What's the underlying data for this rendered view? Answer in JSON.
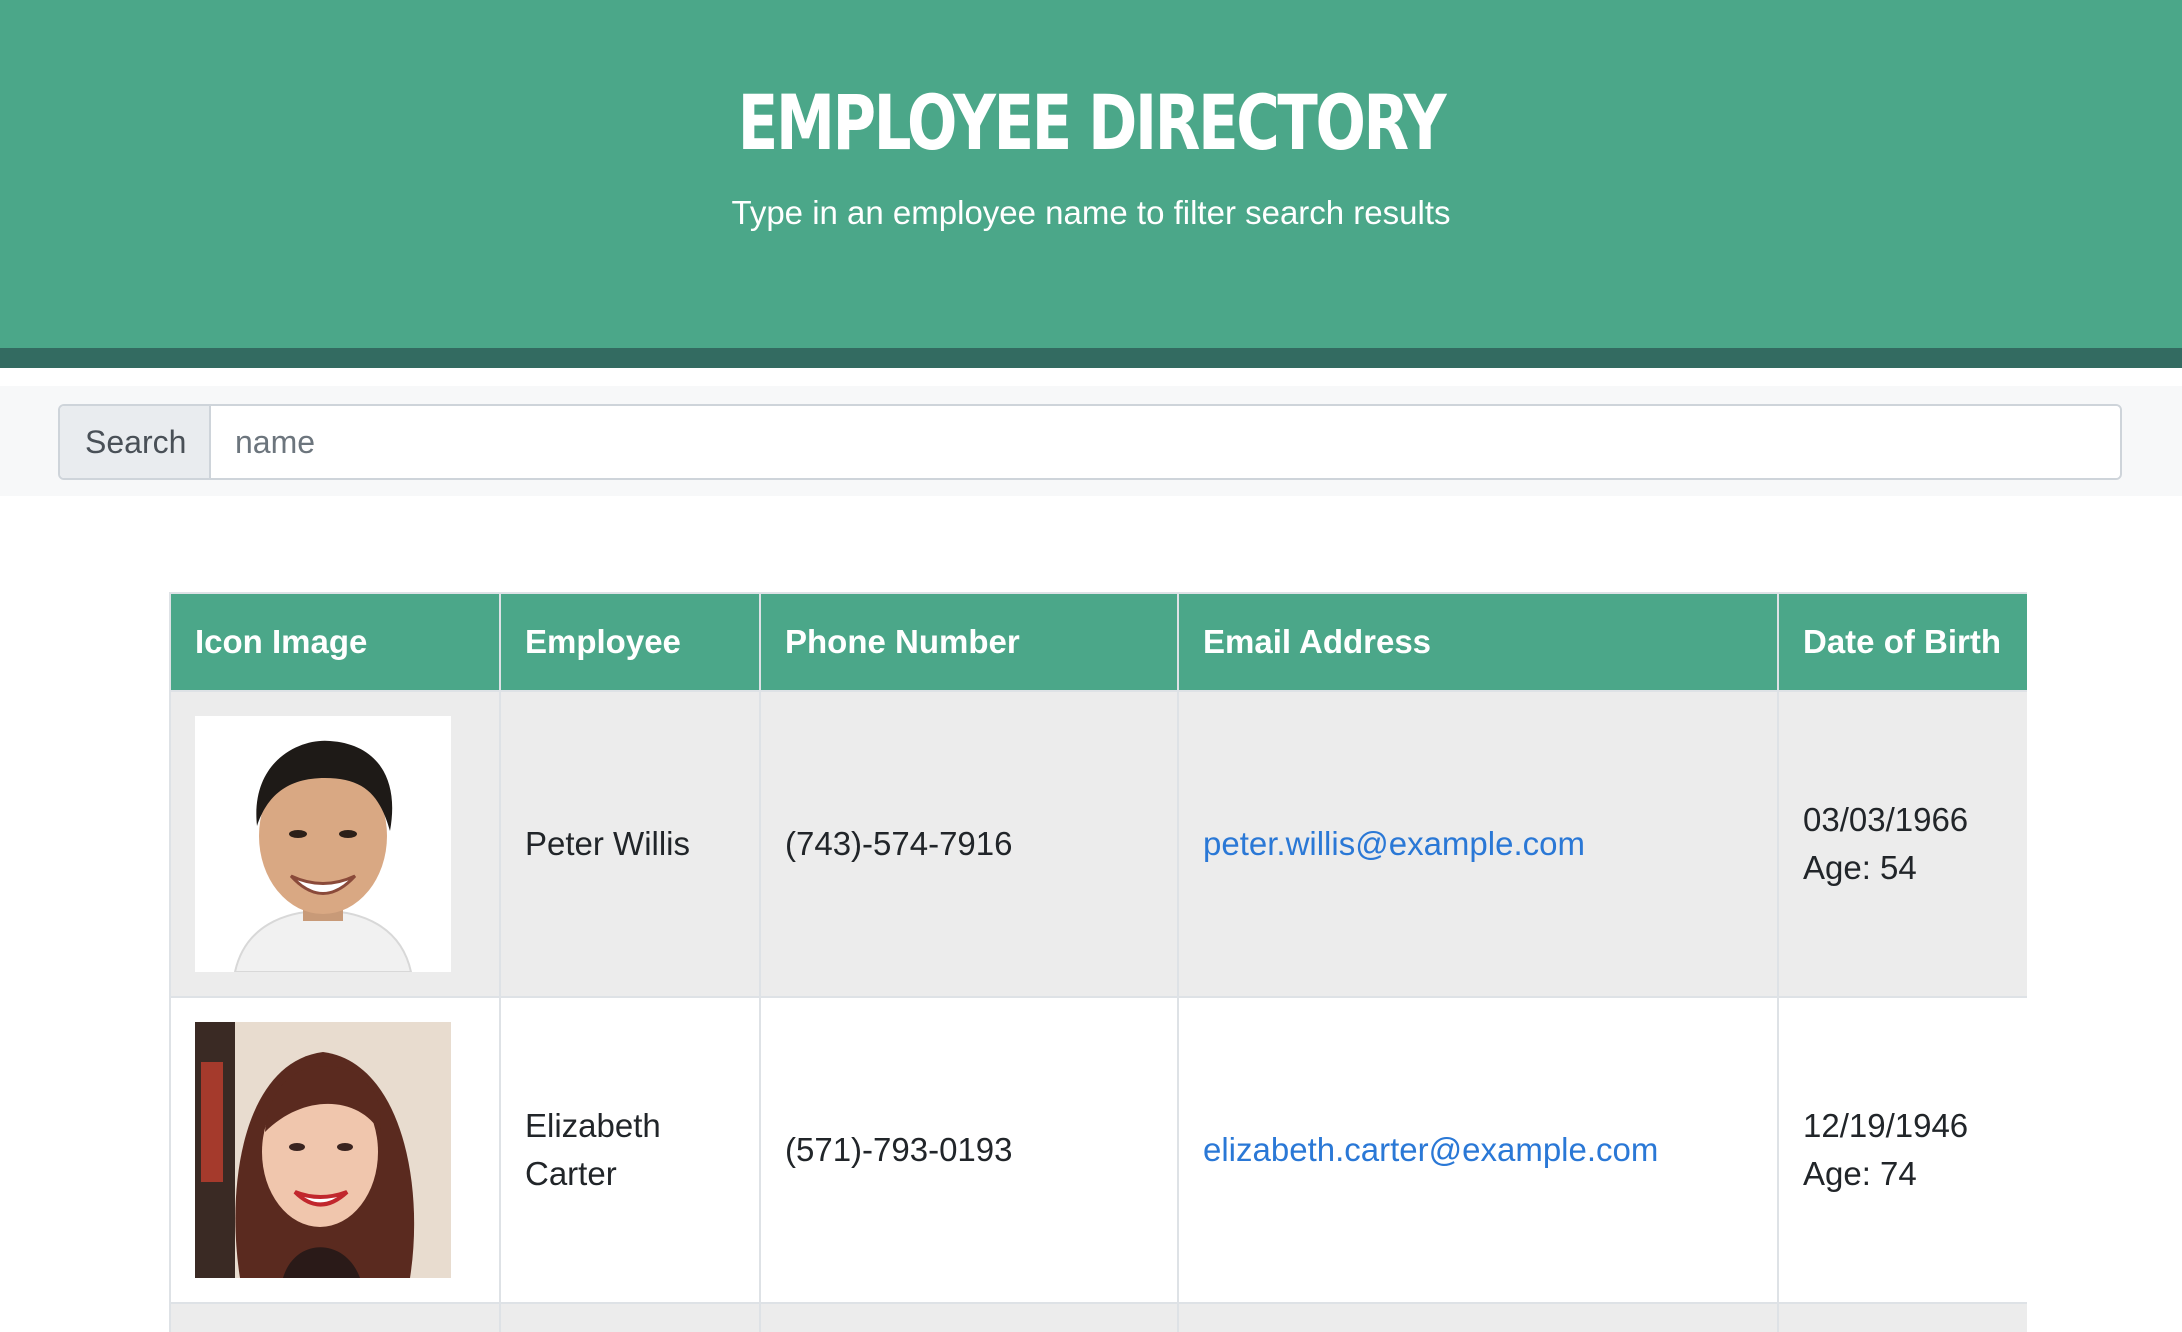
{
  "header": {
    "title": "EMPLOYEE DIRECTORY",
    "subtitle": "Type in an employee name to filter search results"
  },
  "search": {
    "label": "Search",
    "placeholder": "name"
  },
  "table": {
    "columns": [
      "Icon Image",
      "Employee",
      "Phone Number",
      "Email Address",
      "Date of Birth"
    ],
    "rows": [
      {
        "name": "Peter Willis",
        "phone": "(743)-574-7916",
        "email": "peter.willis@example.com",
        "dob": "03/03/1966",
        "age": "Age: 54",
        "avatar_icon": "person-portrait-icon"
      },
      {
        "name": "Elizabeth Carter",
        "phone": "(571)-793-0193",
        "email": "elizabeth.carter@example.com",
        "dob": "12/19/1946",
        "age": "Age: 74",
        "avatar_icon": "person-portrait-icon"
      }
    ]
  },
  "colors": {
    "header_bg": "#4ba789",
    "header_bar": "#336b61",
    "link": "#2a78d6"
  }
}
